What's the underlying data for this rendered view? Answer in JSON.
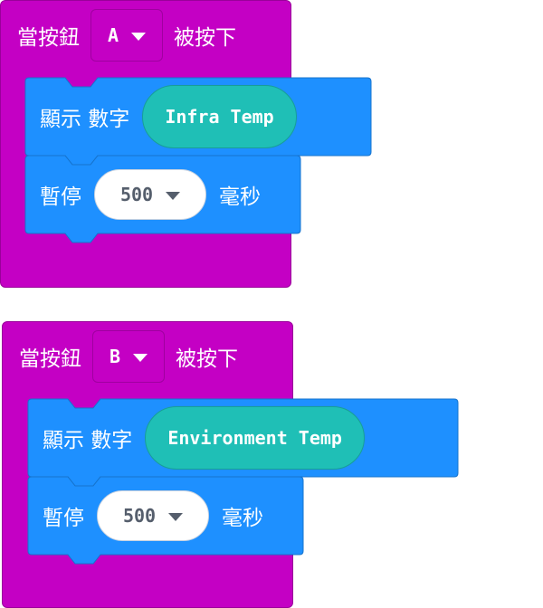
{
  "blocks": [
    {
      "event_prefix": "當按鈕",
      "button_value": "A",
      "event_suffix": "被按下",
      "show_label": "顯示 數字",
      "variable": "Infra Temp",
      "pause_label": "暫停",
      "pause_value": "500",
      "pause_unit": "毫秒"
    },
    {
      "event_prefix": "當按鈕",
      "button_value": "B",
      "event_suffix": "被按下",
      "show_label": "顯示 數字",
      "variable": "Environment Temp",
      "pause_label": "暫停",
      "pause_value": "500",
      "pause_unit": "毫秒"
    }
  ],
  "colors": {
    "event_block": "#c400c4",
    "statement_block": "#1e90ff",
    "variable_pill": "#1fbfb6"
  },
  "icons": {
    "dropdown": "caret-down-icon"
  }
}
